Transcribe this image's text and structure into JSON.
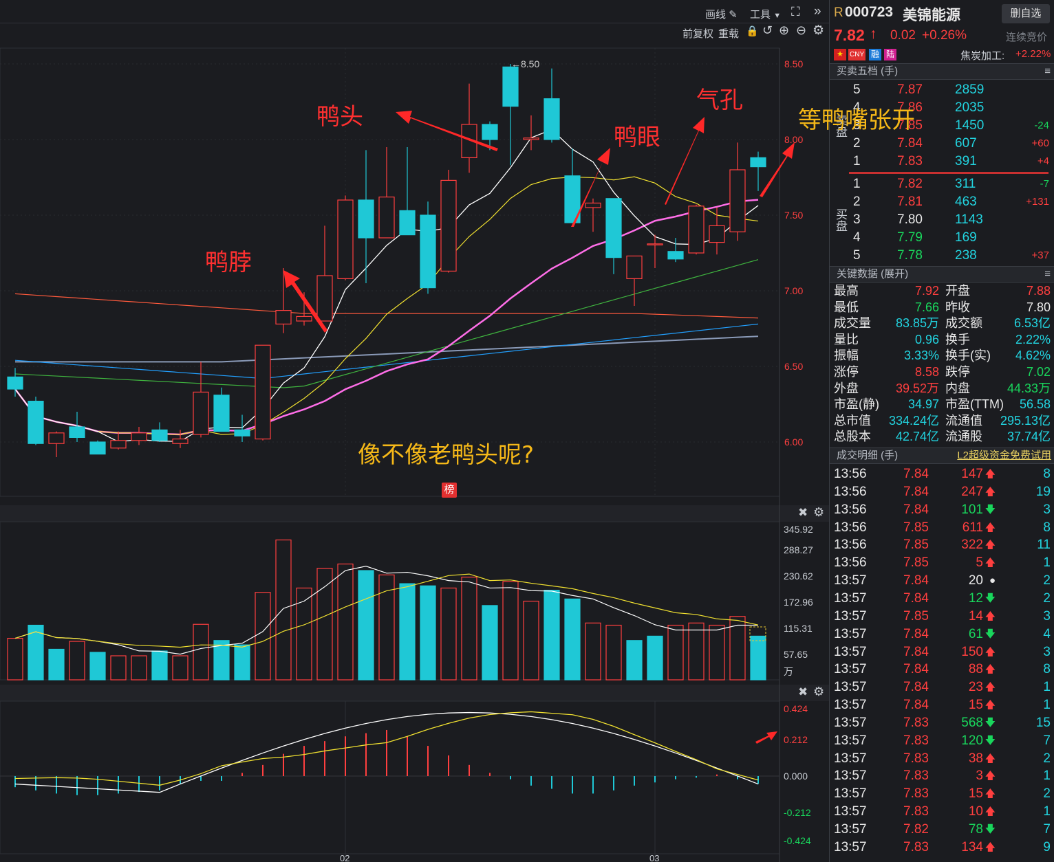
{
  "toolbar": {
    "draw_label": "画线",
    "tools_label": "工具",
    "adjust_label": "前复权",
    "reload_label": "重载"
  },
  "price_axis": [
    "8.50",
    "8.00",
    "7.50",
    "7.00",
    "6.50",
    "6.00"
  ],
  "volume_axis": [
    "345.92",
    "288.27",
    "230.62",
    "172.96",
    "115.31",
    "57.65",
    "万"
  ],
  "macd_axis": [
    "0.424",
    "0.212",
    "0.000",
    "-0.212",
    "-0.424"
  ],
  "date_labels": [
    "02",
    "03"
  ],
  "peak_label": "8.50",
  "rank_badge": "榜",
  "annotations": {
    "duck_head": "鸭头",
    "duck_neck": "鸭脖",
    "duck_eye": "鸭眼",
    "nostril": "气孔",
    "wait_beak": "等鸭嘴张开",
    "question": "像不像老鸭头呢?"
  },
  "chart_data": [
    {
      "type": "candlestick",
      "title": "",
      "ylim": [
        5.65,
        8.55
      ],
      "ticks": [
        6.0,
        6.5,
        7.0,
        7.5,
        8.0,
        8.5
      ],
      "candles": [
        {
          "o": 6.43,
          "h": 6.49,
          "l": 6.3,
          "c": 6.35
        },
        {
          "o": 6.27,
          "h": 6.3,
          "l": 5.98,
          "c": 5.99
        },
        {
          "o": 5.99,
          "h": 6.07,
          "l": 5.9,
          "c": 6.06
        },
        {
          "o": 6.1,
          "h": 6.2,
          "l": 6.0,
          "c": 6.03
        },
        {
          "o": 6.0,
          "h": 6.01,
          "l": 5.93,
          "c": 5.92
        },
        {
          "o": 5.96,
          "h": 6.07,
          "l": 5.95,
          "c": 6.01
        },
        {
          "o": 6.01,
          "h": 6.1,
          "l": 5.98,
          "c": 6.06
        },
        {
          "o": 6.08,
          "h": 6.13,
          "l": 6.0,
          "c": 6.01
        },
        {
          "o": 5.99,
          "h": 6.08,
          "l": 5.96,
          "c": 6.02
        },
        {
          "o": 6.05,
          "h": 6.53,
          "l": 6.03,
          "c": 6.33
        },
        {
          "o": 6.31,
          "h": 6.36,
          "l": 6.07,
          "c": 6.07
        },
        {
          "o": 6.08,
          "h": 6.18,
          "l": 6.0,
          "c": 6.04
        },
        {
          "o": 6.02,
          "h": 6.64,
          "l": 6.01,
          "c": 6.64
        },
        {
          "o": 6.78,
          "h": 7.15,
          "l": 6.72,
          "c": 6.87
        },
        {
          "o": 6.8,
          "h": 6.99,
          "l": 6.77,
          "c": 6.83
        },
        {
          "o": 6.8,
          "h": 7.43,
          "l": 6.8,
          "c": 7.1
        },
        {
          "o": 7.08,
          "h": 7.63,
          "l": 7.07,
          "c": 7.6
        },
        {
          "o": 7.6,
          "h": 7.93,
          "l": 7.05,
          "c": 7.35
        },
        {
          "o": 7.35,
          "h": 7.95,
          "l": 7.35,
          "c": 7.62
        },
        {
          "o": 7.53,
          "h": 7.95,
          "l": 7.37,
          "c": 7.37
        },
        {
          "o": 7.5,
          "h": 7.59,
          "l": 6.98,
          "c": 7.02
        },
        {
          "o": 7.13,
          "h": 7.8,
          "l": 7.12,
          "c": 7.73
        },
        {
          "o": 7.88,
          "h": 8.37,
          "l": 7.78,
          "c": 8.1
        },
        {
          "o": 8.1,
          "h": 8.12,
          "l": 7.93,
          "c": 8.0
        },
        {
          "o": 8.48,
          "h": 8.5,
          "l": 7.83,
          "c": 8.22
        },
        {
          "o": 8.0,
          "h": 8.16,
          "l": 7.93,
          "c": 8.01
        },
        {
          "o": 8.27,
          "h": 8.47,
          "l": 7.98,
          "c": 8.0
        },
        {
          "o": 7.76,
          "h": 7.94,
          "l": 7.46,
          "c": 7.45
        },
        {
          "o": 7.55,
          "h": 7.61,
          "l": 7.39,
          "c": 7.58
        },
        {
          "o": 7.61,
          "h": 7.61,
          "l": 7.11,
          "c": 7.22
        },
        {
          "o": 7.08,
          "h": 7.22,
          "l": 6.9,
          "c": 7.23
        },
        {
          "o": 7.31,
          "h": 7.37,
          "l": 7.15,
          "c": 7.31
        },
        {
          "o": 7.26,
          "h": 7.35,
          "l": 7.19,
          "c": 7.21
        },
        {
          "o": 7.25,
          "h": 7.57,
          "l": 7.24,
          "c": 7.56
        },
        {
          "o": 7.32,
          "h": 7.55,
          "l": 7.24,
          "c": 7.43
        },
        {
          "o": 7.39,
          "h": 7.98,
          "l": 7.33,
          "c": 7.8
        },
        {
          "o": 7.88,
          "h": 7.92,
          "l": 7.66,
          "c": 7.82
        }
      ]
    },
    {
      "type": "bar",
      "title": "volume",
      "unit": "万",
      "ylim": [
        0,
        360
      ],
      "values": [
        95,
        125,
        70,
        88,
        63,
        55,
        55,
        66,
        55,
        127,
        90,
        80,
        200,
        320,
        210,
        255,
        265,
        250,
        240,
        220,
        215,
        210,
        235,
        170,
        225,
        180,
        205,
        185,
        130,
        125,
        90,
        100,
        125,
        130,
        125,
        145,
        100
      ],
      "bullish": [
        true,
        false,
        false,
        true,
        false,
        true,
        true,
        false,
        true,
        true,
        false,
        false,
        true,
        true,
        true,
        true,
        true,
        false,
        true,
        false,
        false,
        true,
        true,
        false,
        true,
        true,
        false,
        false,
        true,
        true,
        false,
        false,
        true,
        true,
        true,
        true,
        false
      ]
    },
    {
      "type": "bar",
      "title": "MACD",
      "ylim": [
        -0.47,
        0.47
      ],
      "values": [
        -0.07,
        -0.09,
        -0.11,
        -0.12,
        -0.12,
        -0.11,
        -0.1,
        -0.09,
        -0.05,
        -0.03,
        -0.03,
        0.02,
        0.07,
        0.14,
        0.19,
        0.22,
        0.25,
        0.27,
        0.29,
        0.25,
        0.19,
        0.13,
        0.07,
        0.02,
        -0.02,
        -0.06,
        -0.08,
        -0.11,
        -0.11,
        -0.09,
        -0.06,
        -0.04,
        -0.02,
        -0.01,
        0.01,
        -0.02,
        -0.05
      ]
    }
  ],
  "quote": {
    "flag": "R",
    "code": "000723",
    "name": "美锦能源",
    "watch_btn": "删自选",
    "price": "7.82",
    "arrow": "↑",
    "change": "0.02",
    "change_pct": "+0.26%",
    "session": "连续竞价",
    "tag_cny": "CNY",
    "tag_rong": "融",
    "tag_lu": "陆",
    "sector": "焦炭加工:",
    "sector_pct": "+2.22%"
  },
  "orderbook": {
    "title": "买卖五档 (手)",
    "sell_label": "卖盘",
    "buy_label": "买盘",
    "asks": [
      {
        "level": "5",
        "price": "7.87",
        "vol": "2859",
        "chg": ""
      },
      {
        "level": "4",
        "price": "7.86",
        "vol": "2035",
        "chg": ""
      },
      {
        "level": "3",
        "price": "7.85",
        "vol": "1450",
        "chg": "-24"
      },
      {
        "level": "2",
        "price": "7.84",
        "vol": "607",
        "chg": "+60"
      },
      {
        "level": "1",
        "price": "7.83",
        "vol": "391",
        "chg": "+4"
      }
    ],
    "bids": [
      {
        "level": "1",
        "price": "7.82",
        "vol": "311",
        "chg": "-7"
      },
      {
        "level": "2",
        "price": "7.81",
        "vol": "463",
        "chg": "+131"
      },
      {
        "level": "3",
        "price": "7.80",
        "vol": "1143",
        "chg": ""
      },
      {
        "level": "4",
        "price": "7.79",
        "vol": "169",
        "chg": ""
      },
      {
        "level": "5",
        "price": "7.78",
        "vol": "238",
        "chg": "+37"
      }
    ]
  },
  "key_data": {
    "title": "关键数据 (展开)",
    "rows": [
      {
        "l1": "最高",
        "v1": "7.92",
        "l2": "开盘",
        "v2": "7.88"
      },
      {
        "l1": "最低",
        "v1": "7.66",
        "l2": "昨收",
        "v2": "7.80"
      },
      {
        "l1": "成交量",
        "v1": "83.85万",
        "l2": "成交额",
        "v2": "6.53亿"
      },
      {
        "l1": "量比",
        "v1": "0.96",
        "l2": "换手",
        "v2": "2.22%"
      },
      {
        "l1": "振幅",
        "v1": "3.33%",
        "l2": "换手(实)",
        "v2": "4.62%"
      },
      {
        "l1": "涨停",
        "v1": "8.58",
        "l2": "跌停",
        "v2": "7.02"
      },
      {
        "l1": "外盘",
        "v1": "39.52万",
        "l2": "内盘",
        "v2": "44.33万"
      },
      {
        "l1": "市盈(静)",
        "v1": "34.97",
        "l2": "市盈(TTM)",
        "v2": "56.58"
      },
      {
        "l1": "总市值",
        "v1": "334.24亿",
        "l2": "流通值",
        "v2": "295.13亿"
      },
      {
        "l1": "总股本",
        "v1": "42.74亿",
        "l2": "流通股",
        "v2": "37.74亿"
      }
    ]
  },
  "trades": {
    "title": "成交明细 (手)",
    "promo": "L2超级资金免费试用",
    "rows": [
      {
        "time": "13:56",
        "price": "7.84",
        "vol": "147",
        "dir": "up",
        "cnt": "8"
      },
      {
        "time": "13:56",
        "price": "7.84",
        "vol": "247",
        "dir": "up",
        "cnt": "19"
      },
      {
        "time": "13:56",
        "price": "7.84",
        "vol": "101",
        "dir": "down",
        "cnt": "3"
      },
      {
        "time": "13:56",
        "price": "7.85",
        "vol": "611",
        "dir": "up",
        "cnt": "8"
      },
      {
        "time": "13:56",
        "price": "7.85",
        "vol": "322",
        "dir": "up",
        "cnt": "11"
      },
      {
        "time": "13:56",
        "price": "7.85",
        "vol": "5",
        "dir": "up",
        "cnt": "1"
      },
      {
        "time": "13:57",
        "price": "7.84",
        "vol": "20",
        "dir": "neutral",
        "cnt": "2"
      },
      {
        "time": "13:57",
        "price": "7.84",
        "vol": "12",
        "dir": "down",
        "cnt": "2"
      },
      {
        "time": "13:57",
        "price": "7.85",
        "vol": "14",
        "dir": "up",
        "cnt": "3"
      },
      {
        "time": "13:57",
        "price": "7.84",
        "vol": "61",
        "dir": "down",
        "cnt": "4"
      },
      {
        "time": "13:57",
        "price": "7.84",
        "vol": "150",
        "dir": "up",
        "cnt": "3"
      },
      {
        "time": "13:57",
        "price": "7.84",
        "vol": "88",
        "dir": "up",
        "cnt": "8"
      },
      {
        "time": "13:57",
        "price": "7.84",
        "vol": "23",
        "dir": "up",
        "cnt": "1"
      },
      {
        "time": "13:57",
        "price": "7.84",
        "vol": "15",
        "dir": "up",
        "cnt": "1"
      },
      {
        "time": "13:57",
        "price": "7.83",
        "vol": "568",
        "dir": "down",
        "cnt": "15"
      },
      {
        "time": "13:57",
        "price": "7.83",
        "vol": "120",
        "dir": "down",
        "cnt": "7"
      },
      {
        "time": "13:57",
        "price": "7.83",
        "vol": "38",
        "dir": "up",
        "cnt": "2"
      },
      {
        "time": "13:57",
        "price": "7.83",
        "vol": "3",
        "dir": "up",
        "cnt": "1"
      },
      {
        "time": "13:57",
        "price": "7.83",
        "vol": "15",
        "dir": "up",
        "cnt": "2"
      },
      {
        "time": "13:57",
        "price": "7.83",
        "vol": "10",
        "dir": "up",
        "cnt": "1"
      },
      {
        "time": "13:57",
        "price": "7.82",
        "vol": "78",
        "dir": "down",
        "cnt": "7"
      },
      {
        "time": "13:57",
        "price": "7.83",
        "vol": "134",
        "dir": "up",
        "cnt": "9"
      }
    ]
  },
  "colors": {
    "up": "#ff3f3f",
    "down": "#1fc8d6",
    "ma5": "#ffffff",
    "ma10": "#f0e030",
    "ma20": "#ff6ee8",
    "ma30": "#3fb43f",
    "ma60": "#22a0ff",
    "ma120": "#ff5a3c",
    "ma250": "#8a9ab8",
    "annotation": "#ff3030",
    "highlight": "#f5b818"
  }
}
